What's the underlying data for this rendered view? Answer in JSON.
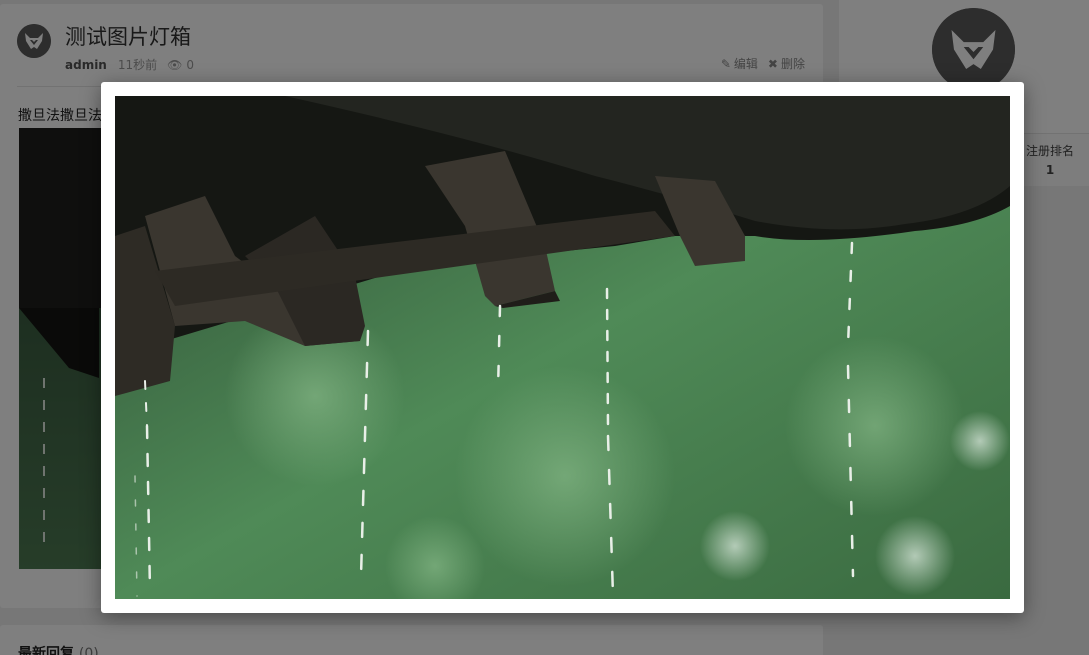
{
  "post": {
    "title": "测试图片灯箱",
    "author": "admin",
    "time": "11秒前",
    "views": "0",
    "edit_label": "编辑",
    "delete_label": "删除",
    "content_text": "撒旦法撒旦法"
  },
  "replies": {
    "title": "最新回复",
    "count": "(0)"
  },
  "sidebar": {
    "stat_label": "注册排名",
    "stat_value": "1"
  },
  "icons": {
    "avatar": "horned-mask-logo",
    "views": "eye-icon",
    "edit": "edit-icon",
    "delete": "close-icon"
  },
  "colors": {
    "overlay": "rgba(0,0,0,0.5)",
    "avatar_bg": "#5a5a5a"
  },
  "lightbox": {
    "image_subject": "rain dripping from dark wooden eaves over blurred green foliage"
  }
}
